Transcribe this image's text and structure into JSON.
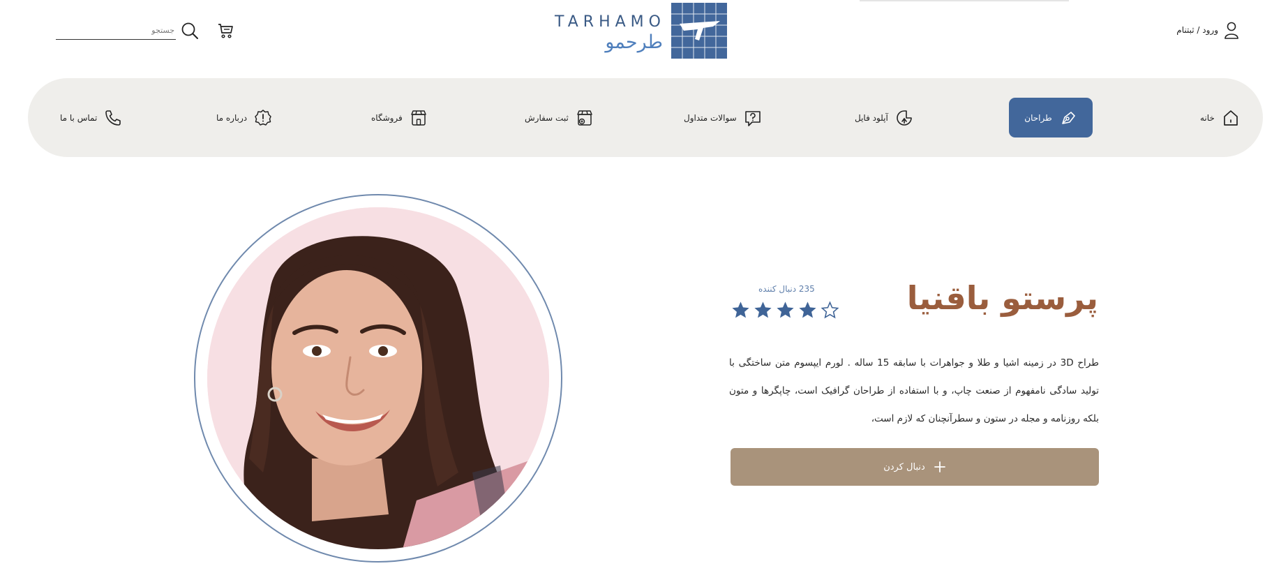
{
  "header": {
    "login_label": "ورود / ثبتنام",
    "search_placeholder": "جستجو",
    "logo": {
      "latin": "TARHAMO",
      "persian": "طرحمو"
    }
  },
  "nav": {
    "items": [
      {
        "label": "خانه",
        "icon": "home-icon",
        "active": false
      },
      {
        "label": "طراحان",
        "icon": "pen-tool-icon",
        "active": true
      },
      {
        "label": "آپلود فایل",
        "icon": "upload-icon",
        "active": false
      },
      {
        "label": "سوالات متداول",
        "icon": "question-icon",
        "active": false
      },
      {
        "label": "ثبت سفارش",
        "icon": "order-icon",
        "active": false
      },
      {
        "label": "فروشگاه",
        "icon": "shop-icon",
        "active": false
      },
      {
        "label": "درباره ما",
        "icon": "info-badge-icon",
        "active": false
      },
      {
        "label": "تماس با ما",
        "icon": "phone-icon",
        "active": false
      }
    ]
  },
  "profile": {
    "name": "پرستو باقنیا",
    "followers": "235 دنبال کننده",
    "rating": 4,
    "rating_max": 5,
    "bio": "طراح 3D در زمینه اشیا و طلا و جواهرات با سابقه 15 ساله . لورم ایپسوم متن ساختگی با تولید سادگی نامفهوم از صنعت چاپ، و با استفاده از طراحان گرافیک است، چاپگرها و متون بلکه روزنامه و مجله در ستون و سطرآنچنان که لازم است،",
    "follow_label": "دنبال کردن"
  },
  "colors": {
    "brand_blue": "#42679b",
    "nav_bg": "#efeeeb",
    "name_brown": "#9a5d3d",
    "button_tan": "#a9937b",
    "star_blue": "#3f6497"
  }
}
